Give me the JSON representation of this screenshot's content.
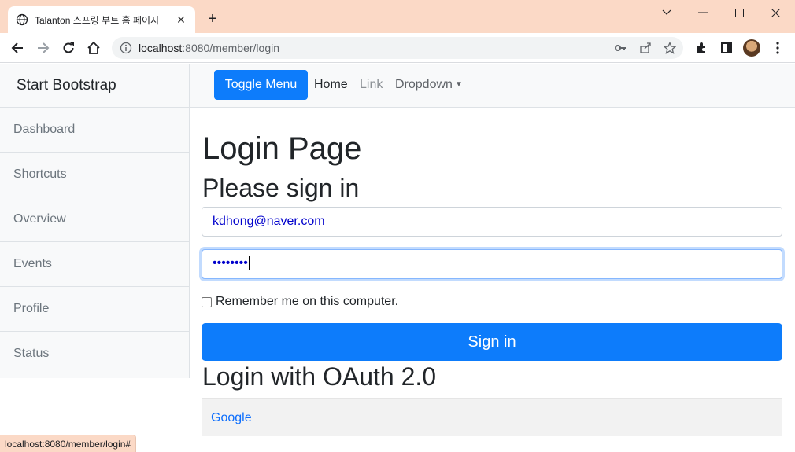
{
  "browser": {
    "tab_title": "Talanton 스프링 부트 홈 페이지",
    "url_host": "localhost",
    "url_path": ":8080/member/login",
    "status_url": "localhost:8080/member/login#"
  },
  "sidebar": {
    "heading": "Start Bootstrap",
    "items": [
      {
        "label": "Dashboard"
      },
      {
        "label": "Shortcuts"
      },
      {
        "label": "Overview"
      },
      {
        "label": "Events"
      },
      {
        "label": "Profile"
      },
      {
        "label": "Status"
      }
    ]
  },
  "topnav": {
    "toggle_label": "Toggle Menu",
    "home_label": "Home",
    "link_label": "Link",
    "dropdown_label": "Dropdown"
  },
  "main": {
    "title": "Login Page",
    "subtitle": "Please sign in",
    "email_value": "kdhong@naver.com",
    "password_value": "••••••••",
    "remember_label": "Remember me on this computer.",
    "signin_label": "Sign in",
    "oauth_heading": "Login with OAuth 2.0",
    "oauth_google_label": "Google"
  },
  "colors": {
    "primary": "#0d7cfb",
    "chrome_frame": "#fbd9c6",
    "link": "#0d6efd"
  }
}
